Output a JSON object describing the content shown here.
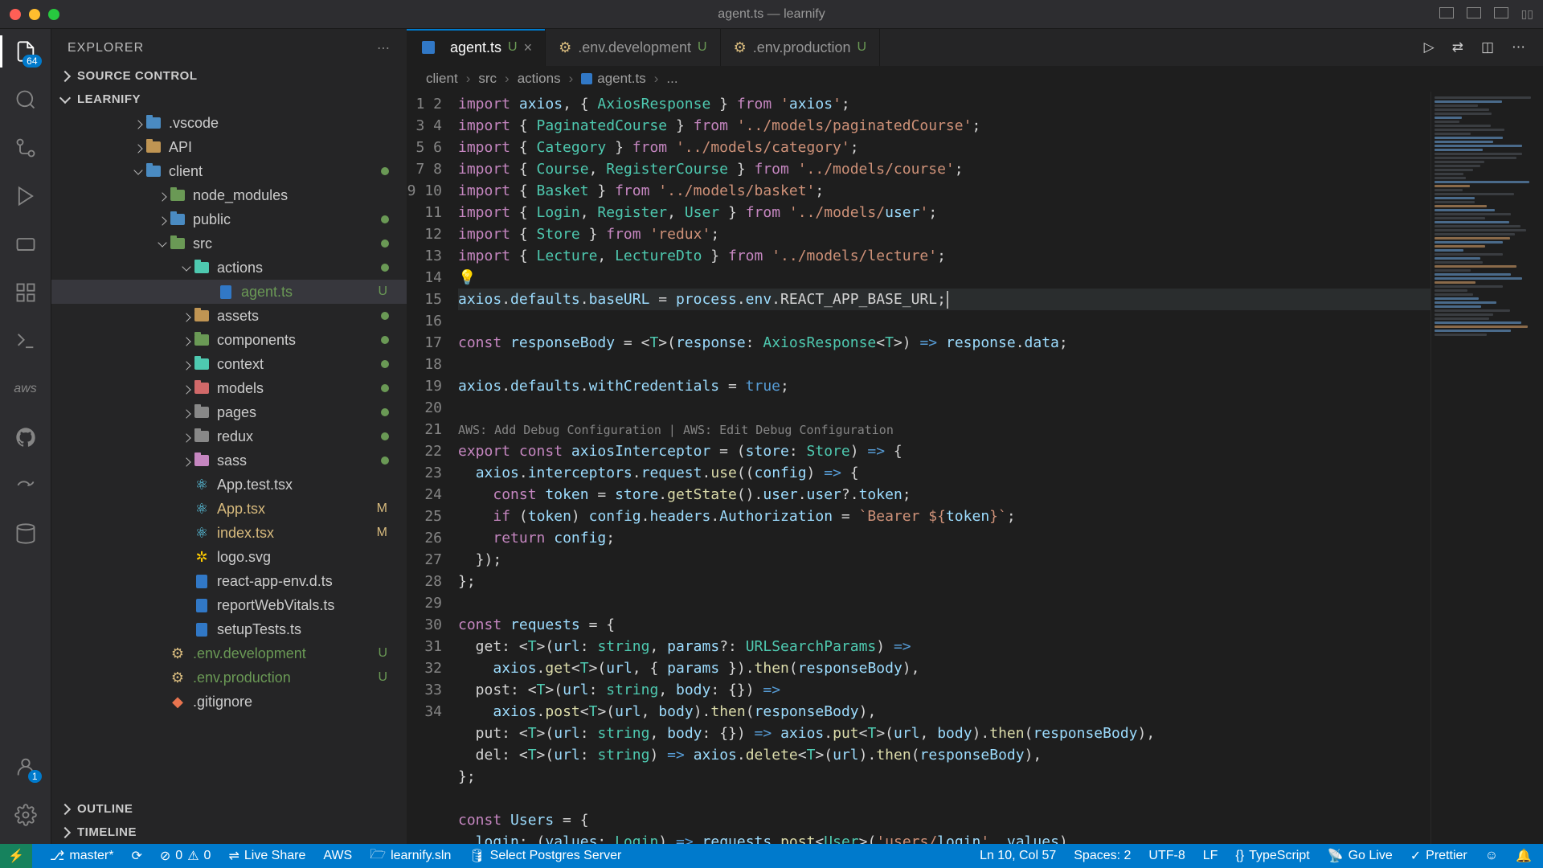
{
  "window": {
    "title": "agent.ts — learnify"
  },
  "activity": {
    "explorer_badge": "64",
    "account_badge": "1"
  },
  "sidebar": {
    "title": "EXPLORER",
    "sections": {
      "source_control": "SOURCE CONTROL",
      "project": "LEARNIFY",
      "outline": "OUTLINE",
      "timeline": "TIMELINE"
    },
    "tree": {
      "vscode": ".vscode",
      "api": "API",
      "client": "client",
      "node_modules": "node_modules",
      "public": "public",
      "src": "src",
      "actions": "actions",
      "agent": "agent.ts",
      "assets": "assets",
      "components": "components",
      "context": "context",
      "models": "models",
      "pages": "pages",
      "redux": "redux",
      "sass": "sass",
      "apptest": "App.test.tsx",
      "apptsx": "App.tsx",
      "indextsx": "index.tsx",
      "logo": "logo.svg",
      "reactenv": "react-app-env.d.ts",
      "webvitals": "reportWebVitals.ts",
      "setuptests": "setupTests.ts",
      "envdev": ".env.development",
      "envprod": ".env.production",
      "gitignore": ".gitignore"
    },
    "status": {
      "U": "U",
      "M": "M"
    }
  },
  "tabs": {
    "agent": {
      "label": "agent.ts",
      "status": "U"
    },
    "envdev": {
      "label": ".env.development",
      "status": "U"
    },
    "envprod": {
      "label": ".env.production",
      "status": "U"
    }
  },
  "breadcrumb": {
    "p1": "client",
    "p2": "src",
    "p3": "actions",
    "p4": "agent.ts",
    "p5": "..."
  },
  "codelens": "AWS: Add Debug Configuration | AWS: Edit Debug Configuration",
  "statusbar": {
    "branch": "master*",
    "errors": "0",
    "warnings": "0",
    "liveshare": "Live Share",
    "aws": "AWS",
    "sln": "learnify.sln",
    "postgres": "Select Postgres Server",
    "pos": "Ln 10, Col 57",
    "spaces": "Spaces: 2",
    "enc": "UTF-8",
    "eol": "LF",
    "lang": "TypeScript",
    "golive": "Go Live",
    "prettier": "Prettier"
  },
  "code_lines": [
    "import axios, { AxiosResponse } from 'axios';",
    "import { PaginatedCourse } from '../models/paginatedCourse';",
    "import { Category } from '../models/category';",
    "import { Course, RegisterCourse } from '../models/course';",
    "import { Basket } from '../models/basket';",
    "import { Login, Register, User } from '../models/user';",
    "import { Store } from 'redux';",
    "import { Lecture, LectureDto } from '../models/lecture';",
    "",
    "axios.defaults.baseURL = process.env.REACT_APP_BASE_URL;",
    "",
    "const responseBody = <T>(response: AxiosResponse<T>) => response.data;",
    "",
    "axios.defaults.withCredentials = true;",
    "",
    "export const axiosInterceptor = (store: Store) => {",
    "  axios.interceptors.request.use((config) => {",
    "    const token = store.getState().user.user?.token;",
    "    if (token) config.headers.Authorization = `Bearer ${token}`;",
    "    return config;",
    "  });",
    "};",
    "",
    "const requests = {",
    "  get: <T>(url: string, params?: URLSearchParams) =>",
    "    axios.get<T>(url, { params }).then(responseBody),",
    "  post: <T>(url: string, body: {}) =>",
    "    axios.post<T>(url, body).then(responseBody),",
    "  put: <T>(url: string, body: {}) => axios.put<T>(url, body).then(responseBody),",
    "  del: <T>(url: string) => axios.delete<T>(url).then(responseBody),",
    "};",
    "",
    "const Users = {",
    "  login: (values: Login) => requests.post<User>('users/login', values),"
  ]
}
